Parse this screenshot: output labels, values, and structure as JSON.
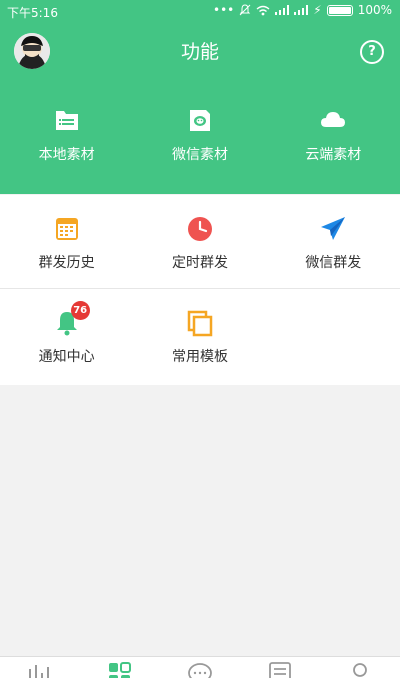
{
  "status_bar": {
    "time": "下午5:16",
    "battery": "100%"
  },
  "header": {
    "title": "功能",
    "help_icon": "question-circle-icon"
  },
  "top_actions": [
    {
      "label": "本地素材",
      "icon": "folder-icon"
    },
    {
      "label": "微信素材",
      "icon": "wechat-doc-icon"
    },
    {
      "label": "云端素材",
      "icon": "cloud-icon"
    }
  ],
  "features": [
    {
      "label": "群发历史",
      "icon": "calendar-icon"
    },
    {
      "label": "定时群发",
      "icon": "clock-icon"
    },
    {
      "label": "微信群发",
      "icon": "paper-plane-icon"
    },
    {
      "label": "通知中心",
      "icon": "bell-icon",
      "badge": "76"
    },
    {
      "label": "常用模板",
      "icon": "template-icon"
    }
  ],
  "colors": {
    "primary_green": "#43c584",
    "badge_red": "#e53935",
    "calendar_orange": "#f5a623",
    "clock_red": "#ef5350",
    "plane_blue": "#1e88e5"
  }
}
